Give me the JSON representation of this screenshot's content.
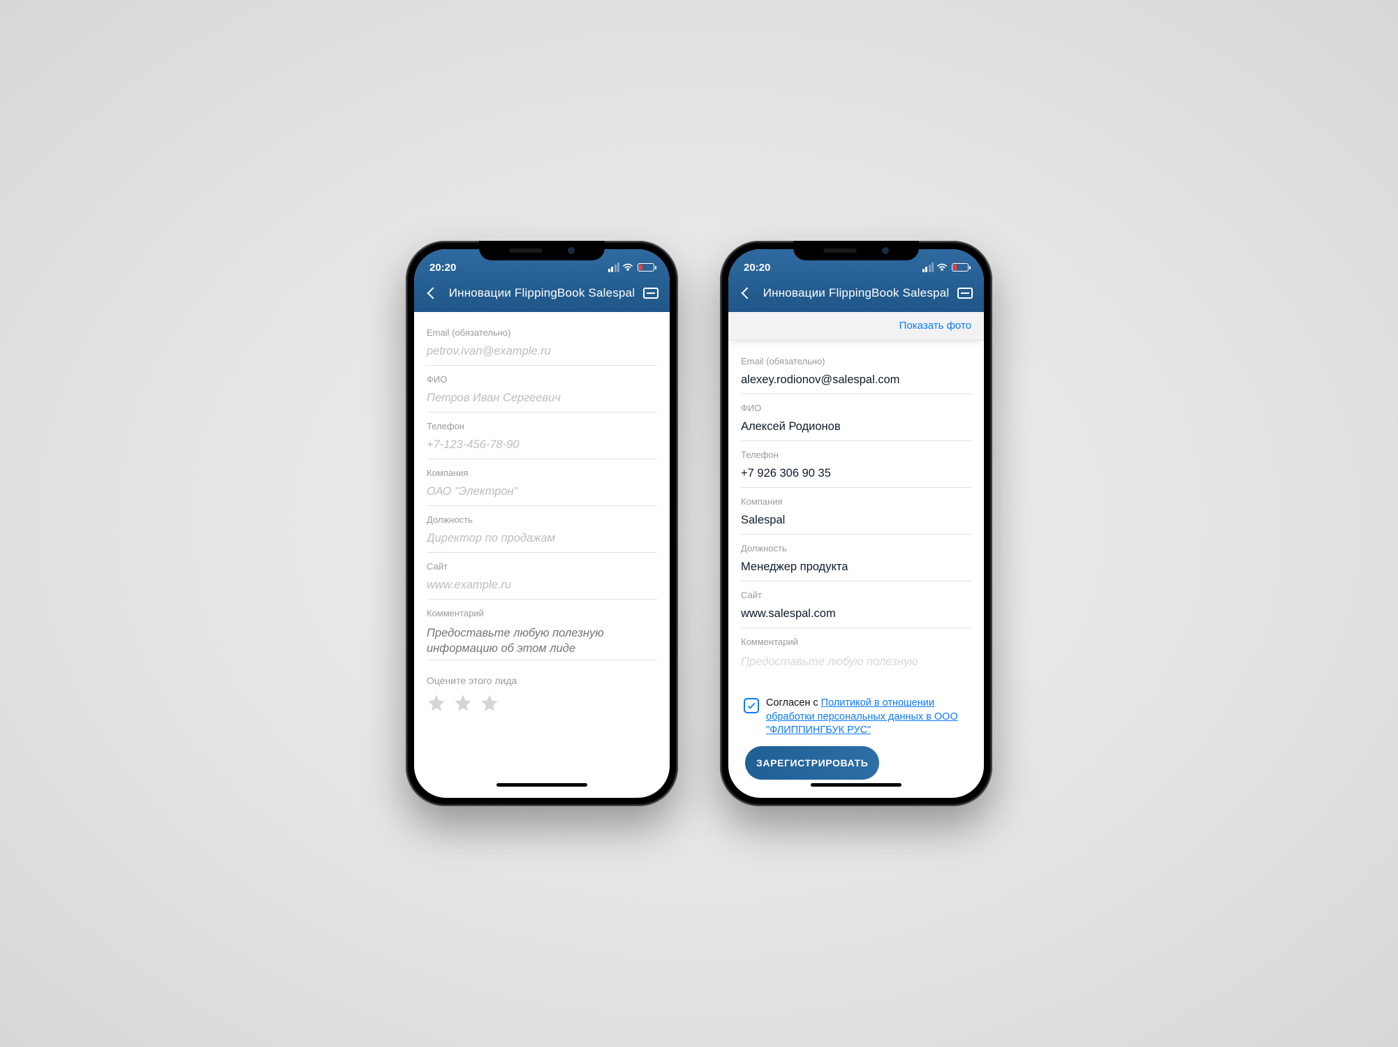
{
  "status": {
    "time": "20:20"
  },
  "header": {
    "title": "Инновации FlippingBook Salespal"
  },
  "left": {
    "fields": {
      "email": {
        "label": "Email (обязательно)",
        "placeholder": "petrov.ivan@example.ru"
      },
      "name": {
        "label": "ФИО",
        "placeholder": "Петров Иван Сергеевич"
      },
      "phone": {
        "label": "Телефон",
        "placeholder": "+7-123-456-78-90"
      },
      "company": {
        "label": "Компания",
        "placeholder": "ОАО \"Электрон\""
      },
      "role": {
        "label": "Должность",
        "placeholder": "Директор по продажам"
      },
      "site": {
        "label": "Сайт",
        "placeholder": "www.example.ru"
      },
      "comment": {
        "label": "Комментарий",
        "placeholder": "Предоставьте любую полезную информацию об этом лиде"
      }
    },
    "rate_label": "Оцените этого лида"
  },
  "right": {
    "show_photo": "Показать фото",
    "fields": {
      "email": {
        "label": "Email (обязательно)",
        "value": "alexey.rodionov@salespal.com"
      },
      "name": {
        "label": "ФИО",
        "value": "Алексей Родионов"
      },
      "phone": {
        "label": "Телефон",
        "value": "+7 926 306 90 35"
      },
      "company": {
        "label": "Компания",
        "value": "Salespal"
      },
      "role": {
        "label": "Должность",
        "value": "Менеджер продукта"
      },
      "site": {
        "label": "Сайт",
        "value": "www.salespal.com"
      },
      "comment": {
        "label": "Комментарий",
        "value_peek": "Предоставьте любую полезную"
      }
    },
    "consent": {
      "checked": true,
      "prefix": "Согласен с ",
      "link": "Политикой в отношении обработки персональных данных в ООО \"ФЛИППИНГБУК РУС\""
    },
    "register_label": "ЗАРЕГИСТРИРОВАТЬ"
  }
}
